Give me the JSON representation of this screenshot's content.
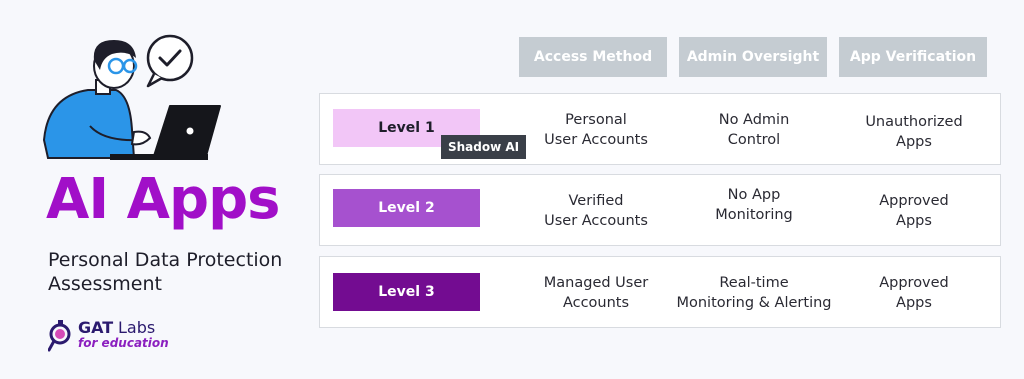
{
  "title": "AI Apps",
  "subtitle": "Personal Data Protection Assessment",
  "logo": {
    "brand": "GAT",
    "suffix": "Labs",
    "tagline": "for education"
  },
  "columns": [
    "Access Method",
    "Admin Oversight",
    "App Verification"
  ],
  "rows": [
    {
      "level": "Level 1",
      "badge": "Shadow AI",
      "access": "Personal\nUser Accounts",
      "oversight": "No Admin\nControl",
      "verification": "Unauthorized\nApps"
    },
    {
      "level": "Level 2",
      "access": "Verified\nUser Accounts",
      "oversight": "No App\nMonitoring",
      "verification": "Approved\nApps"
    },
    {
      "level": "Level 3",
      "access": "Managed User\nAccounts",
      "oversight": "Real-time\nMonitoring & Alerting",
      "verification": "Approved\nApps"
    }
  ],
  "colors": {
    "title": "#a10fc8",
    "level1": "#f2c6f7",
    "level2": "#a651cf",
    "level3": "#730c91",
    "header_bg": "#c5ccd2",
    "badge_bg": "#3a3f48"
  },
  "icons": [
    "person-at-laptop-illustration",
    "checkmark-speech-bubble-icon",
    "gat-labs-logo-icon"
  ]
}
